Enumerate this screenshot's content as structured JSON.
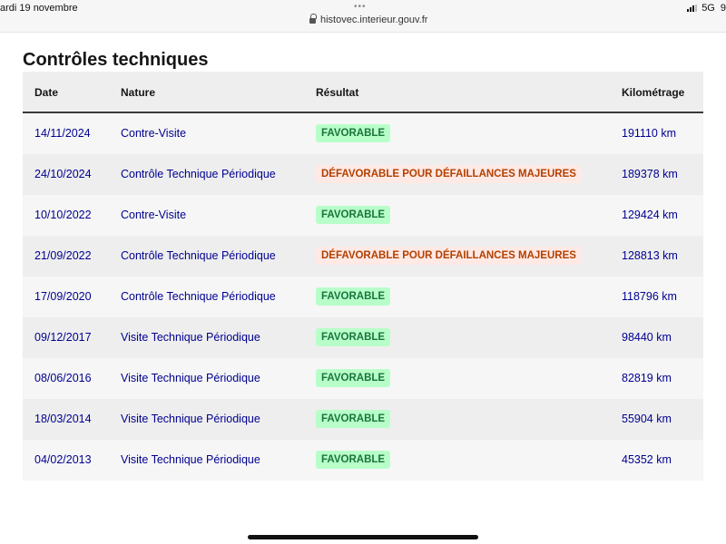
{
  "statusbar": {
    "date": "ardi 19 novembre",
    "dots": "•••",
    "url": "histovec.interieur.gouv.fr",
    "network": "5G",
    "battery": "9"
  },
  "page": {
    "title": "Contrôles techniques"
  },
  "table": {
    "headers": {
      "date": "Date",
      "nature": "Nature",
      "result": "Résultat",
      "km": "Kilométrage"
    },
    "rows": [
      {
        "date": "14/11/2024",
        "nature": "Contre-Visite",
        "result": "FAVORABLE",
        "status": "fav",
        "km": "191110 km"
      },
      {
        "date": "24/10/2024",
        "nature": "Contrôle Technique Périodique",
        "result": "DÉFAVORABLE POUR DÉFAILLANCES MAJEURES",
        "status": "defav",
        "km": "189378 km"
      },
      {
        "date": "10/10/2022",
        "nature": "Contre-Visite",
        "result": "FAVORABLE",
        "status": "fav",
        "km": "129424 km"
      },
      {
        "date": "21/09/2022",
        "nature": "Contrôle Technique Périodique",
        "result": "DÉFAVORABLE POUR DÉFAILLANCES MAJEURES",
        "status": "defav",
        "km": "128813 km"
      },
      {
        "date": "17/09/2020",
        "nature": "Contrôle Technique Périodique",
        "result": "FAVORABLE",
        "status": "fav",
        "km": "118796 km"
      },
      {
        "date": "09/12/2017",
        "nature": "Visite Technique Périodique",
        "result": "FAVORABLE",
        "status": "fav",
        "km": "98440 km"
      },
      {
        "date": "08/06/2016",
        "nature": "Visite Technique Périodique",
        "result": "FAVORABLE",
        "status": "fav",
        "km": "82819 km"
      },
      {
        "date": "18/03/2014",
        "nature": "Visite Technique Périodique",
        "result": "FAVORABLE",
        "status": "fav",
        "km": "55904 km"
      },
      {
        "date": "04/02/2013",
        "nature": "Visite Technique Périodique",
        "result": "FAVORABLE",
        "status": "fav",
        "km": "45352 km"
      }
    ]
  },
  "colors": {
    "link_blue": "#000091",
    "favorable_bg": "#b8fec9",
    "favorable_text": "#18753c",
    "defavorable_bg": "#fee9e5",
    "defavorable_text": "#b34000"
  },
  "icons": {
    "lock": "lock-icon",
    "signal": "cellular-signal-icon",
    "tab_overview": "ellipsis-icon"
  }
}
